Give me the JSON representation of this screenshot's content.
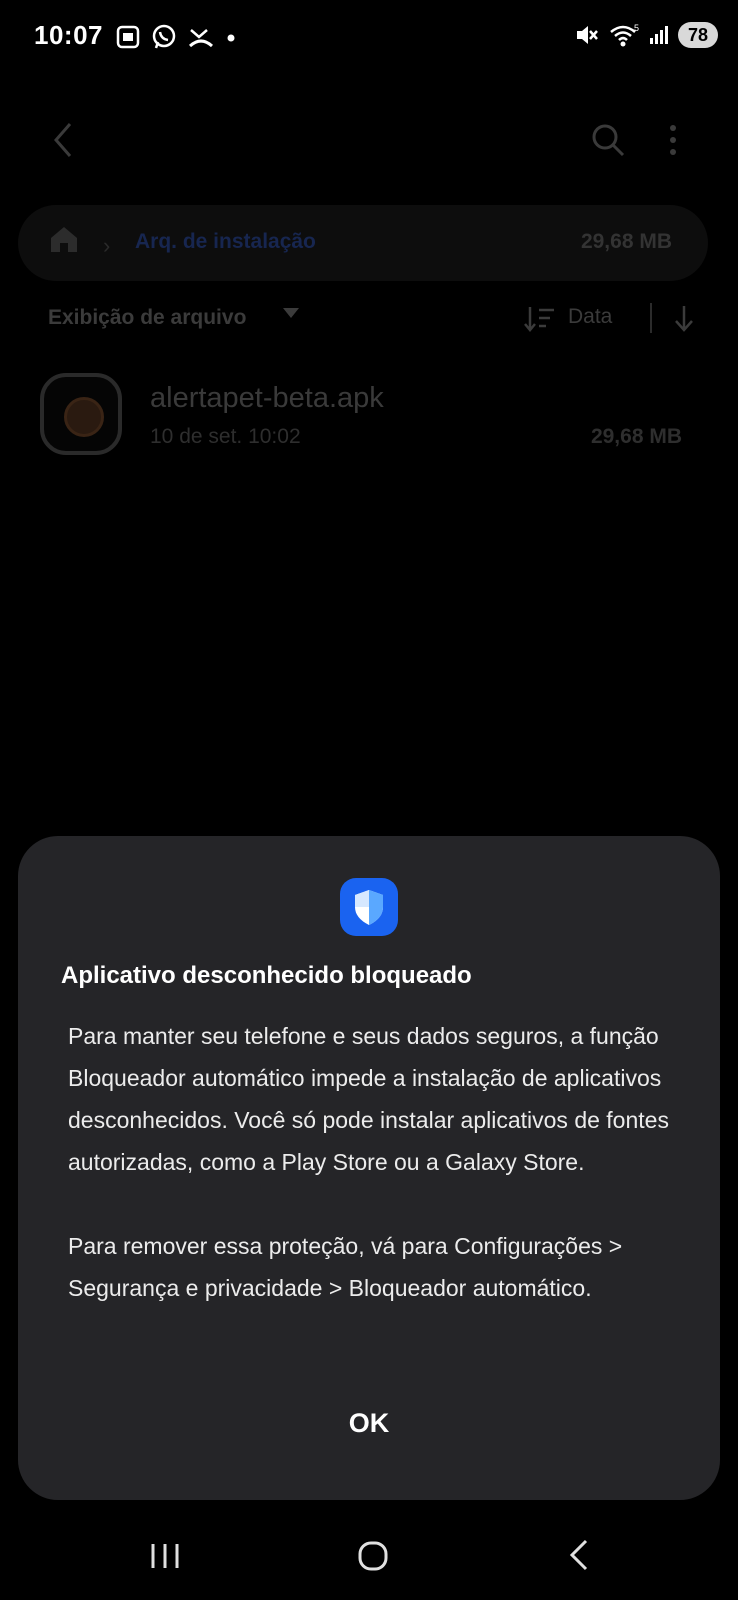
{
  "status_bar": {
    "time": "10:07",
    "battery": "78",
    "network_label": "5",
    "left_icons": [
      "screenshot-icon",
      "whatsapp-icon",
      "missed-call-icon",
      "dot-icon"
    ],
    "right_icons": [
      "mute-icon",
      "wifi-icon",
      "signal-icon"
    ]
  },
  "file_manager": {
    "path": {
      "folder_label": "Arq. de instalação",
      "size": "29,68 MB"
    },
    "view": {
      "label": "Exibição de arquivo",
      "sort_label": "Data"
    },
    "files": [
      {
        "name": "alertapet-beta.apk",
        "date": "10 de set. 10:02",
        "size": "29,68 MB"
      }
    ]
  },
  "dialog": {
    "title": "Aplicativo desconhecido bloqueado",
    "paragraph1": "Para manter seu telefone e seus dados seguros, a função Bloqueador automático impede a instalação de aplicativos desconhecidos. Você só pode instalar aplicativos de fontes autorizadas, como a Play Store ou a Galaxy Store.",
    "paragraph2": "Para remover essa proteção, vá para Configurações > Segurança e privacidade > Bloqueador automático.",
    "ok_label": "OK"
  },
  "colors": {
    "dialog_bg": "#252528",
    "shield_blue": "#1a63f0",
    "background": "#000000"
  }
}
